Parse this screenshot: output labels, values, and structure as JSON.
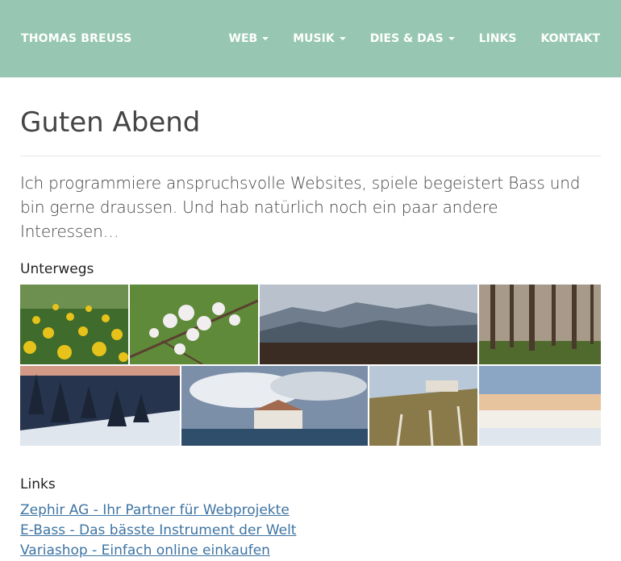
{
  "navbar": {
    "brand": "THOMAS BREUSS",
    "items": [
      {
        "label": "WEB",
        "dropdown": true
      },
      {
        "label": "MUSIK",
        "dropdown": true
      },
      {
        "label": "DIES & DAS",
        "dropdown": true
      },
      {
        "label": "LINKS",
        "dropdown": false
      },
      {
        "label": "KONTAKT",
        "dropdown": false
      }
    ]
  },
  "main": {
    "title": "Guten Abend",
    "intro": "Ich programmiere anspruchsvolle Websites, spiele begeistert Bass und bin gerne draussen. Und hab natürlich noch ein paar andere Interessen…",
    "gallery_title": "Unterwegs",
    "gallery": [
      {
        "subject": "dandelion-meadow"
      },
      {
        "subject": "cherry-blossoms"
      },
      {
        "subject": "mountain-panorama"
      },
      {
        "subject": "forest-trees"
      },
      {
        "subject": "snowy-fir-trees"
      },
      {
        "subject": "lake-castle"
      },
      {
        "subject": "village-vineyard"
      },
      {
        "subject": "sea-of-fog"
      }
    ],
    "links_title": "Links",
    "links": [
      {
        "label": "Zephir AG - Ihr Partner für Webprojekte"
      },
      {
        "label": "E-Bass - Das bässte Instrument der Welt"
      },
      {
        "label": "Variashop - Einfach online einkaufen"
      }
    ]
  },
  "colors": {
    "navbar_bg": "#97c7b2",
    "link": "#3d74a3"
  }
}
